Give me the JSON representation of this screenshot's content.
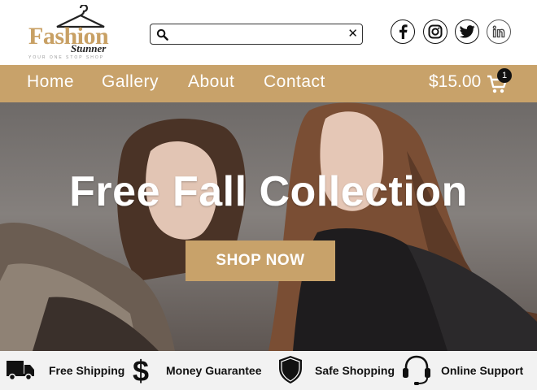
{
  "logo": {
    "line1": "Fashion",
    "line2": "Stunner",
    "tagline": "YOUR ONE STOP SHOP"
  },
  "search": {
    "value": "",
    "placeholder": ""
  },
  "socials": [
    "facebook-icon",
    "instagram-icon",
    "twitter-icon",
    "linkedin-icon"
  ],
  "nav": {
    "items": [
      "Home",
      "Gallery",
      "About",
      "Contact"
    ],
    "cart_total": "$15.00",
    "cart_count": "1"
  },
  "hero": {
    "title": "Free Fall Collection",
    "button": "SHOP NOW"
  },
  "features": [
    {
      "icon": "truck-icon",
      "label": "Free Shipping"
    },
    {
      "icon": "dollar-icon",
      "label": "Money Guarantee"
    },
    {
      "icon": "shield-icon",
      "label": "Safe Shopping"
    },
    {
      "icon": "headset-icon",
      "label": "Online Support"
    }
  ],
  "colors": {
    "accent": "#c8a26a",
    "dark": "#111111"
  }
}
